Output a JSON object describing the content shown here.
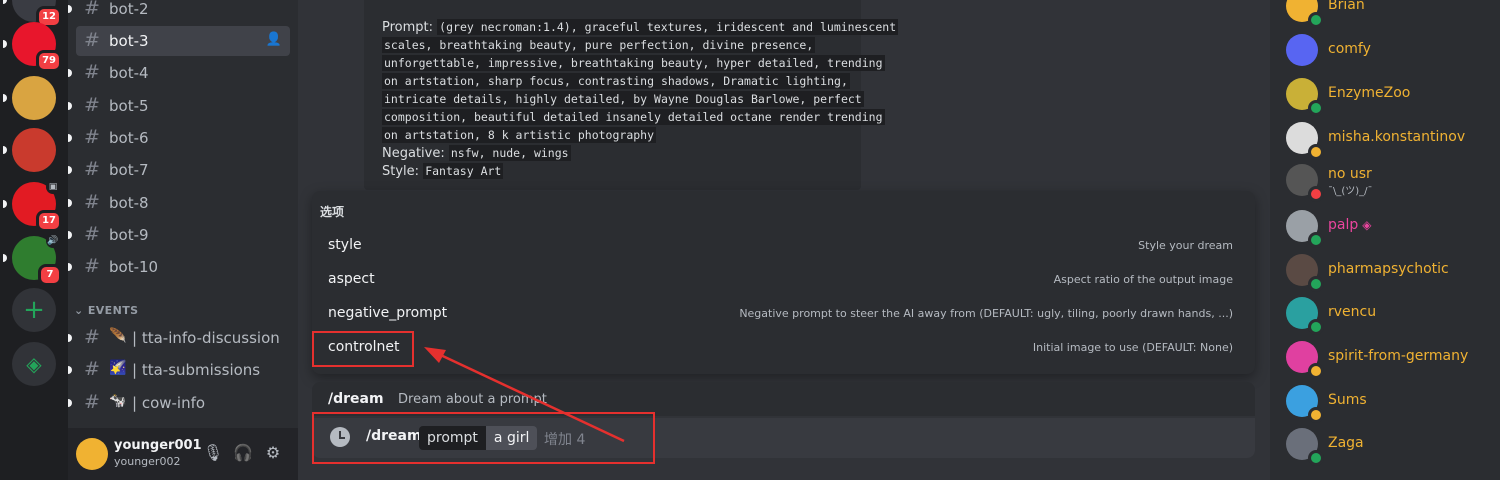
{
  "servers": [
    {
      "id": "s1",
      "badge": "12",
      "color": "#3a3c43"
    },
    {
      "id": "s2",
      "badge": "79",
      "color": "#e8162c"
    },
    {
      "id": "s3",
      "badge": "",
      "color": "#d9a441"
    },
    {
      "id": "s4",
      "badge": "",
      "color": "#c93a2d"
    },
    {
      "id": "s5",
      "badge": "17",
      "color": "#e21b23"
    },
    {
      "id": "s6",
      "badge": "7",
      "color": "#2f7d2f"
    }
  ],
  "add_server_symbol": "+",
  "explore_symbol": "◈",
  "channels": [
    {
      "hash": "#",
      "name": "bot-2"
    },
    {
      "hash": "#",
      "name": "bot-3"
    },
    {
      "hash": "#",
      "name": "bot-4"
    },
    {
      "hash": "#",
      "name": "bot-5"
    },
    {
      "hash": "#",
      "name": "bot-6"
    },
    {
      "hash": "#",
      "name": "bot-7"
    },
    {
      "hash": "#",
      "name": "bot-8"
    },
    {
      "hash": "#",
      "name": "bot-9"
    },
    {
      "hash": "#",
      "name": "bot-10"
    }
  ],
  "events_category": "EVENTS",
  "event_channels": [
    {
      "hash": "#",
      "emoji": "🪶",
      "name": "| tta-info-discussion"
    },
    {
      "hash": "#",
      "emoji": "🌠",
      "name": "| tta-submissions"
    },
    {
      "hash": "#",
      "emoji": "🐄",
      "name": "| cow-info"
    }
  ],
  "user": {
    "name": "younger001",
    "tag": "younger002"
  },
  "embed": {
    "prompt_label": "Prompt:",
    "prompt_lines": [
      "(grey necroman:1.4), graceful textures, iridescent and luminescent",
      "scales, breathtaking beauty, pure perfection, divine presence,",
      "unforgettable, impressive, breathtaking beauty, hyper detailed, trending",
      "on artstation, sharp focus, contrasting shadows, Dramatic lighting,",
      "intricate details, highly detailed, by Wayne Douglas Barlowe, perfect",
      "composition, beautiful detailed insanely detailed octane render trending",
      "on artstation, 8 k artistic photography"
    ],
    "negative_label": "Negative:",
    "negative_value": "nsfw, nude, wings",
    "style_label": "Style:",
    "style_value": "Fantasy Art"
  },
  "popup": {
    "title": "选项",
    "options": [
      {
        "name": "style",
        "desc": "Style your dream"
      },
      {
        "name": "aspect",
        "desc": "Aspect ratio of the output image"
      },
      {
        "name": "negative_prompt",
        "desc": "Negative prompt to steer the AI away from (DEFAULT: ugly, tiling, poorly drawn hands, ...)"
      },
      {
        "name": "controlnet",
        "desc": "Initial image to use (DEFAULT: None)"
      }
    ]
  },
  "command_hint": {
    "name": "/dream",
    "desc": "Dream about a prompt"
  },
  "input": {
    "command": "/dream",
    "param_key": "prompt",
    "param_value": "a girl",
    "add_more": "增加 4"
  },
  "annotation_color": "#e5302e",
  "members": [
    {
      "name": "Brian",
      "color": "#f0b232",
      "status": "online",
      "sub": ""
    },
    {
      "name": "comfy",
      "color": "#5865f2",
      "status": "",
      "sub": ""
    },
    {
      "name": "EnzymeZoo",
      "color": "#c9b037",
      "status": "online",
      "sub": ""
    },
    {
      "name": "misha.konstantinov",
      "color": "#dcdcdc",
      "status": "idle",
      "sub": ""
    },
    {
      "name": "no usr",
      "color": "#555555",
      "status": "dnd",
      "sub": "¯\\_(ツ)_/¯"
    },
    {
      "name": "palp",
      "color": "#9aa0a6",
      "status": "online",
      "sub": "",
      "pink": true
    },
    {
      "name": "pharmapsychotic",
      "color": "#5a4a44",
      "status": "online",
      "sub": ""
    },
    {
      "name": "rvencu",
      "color": "#2aa0a0",
      "status": "online",
      "sub": ""
    },
    {
      "name": "spirit-from-germany",
      "color": "#e040a0",
      "status": "idle",
      "sub": ""
    },
    {
      "name": "Sums",
      "color": "#3ba0e0",
      "status": "idle",
      "sub": ""
    },
    {
      "name": "Zaga",
      "color": "#6a6f7a",
      "status": "online",
      "sub": ""
    }
  ]
}
